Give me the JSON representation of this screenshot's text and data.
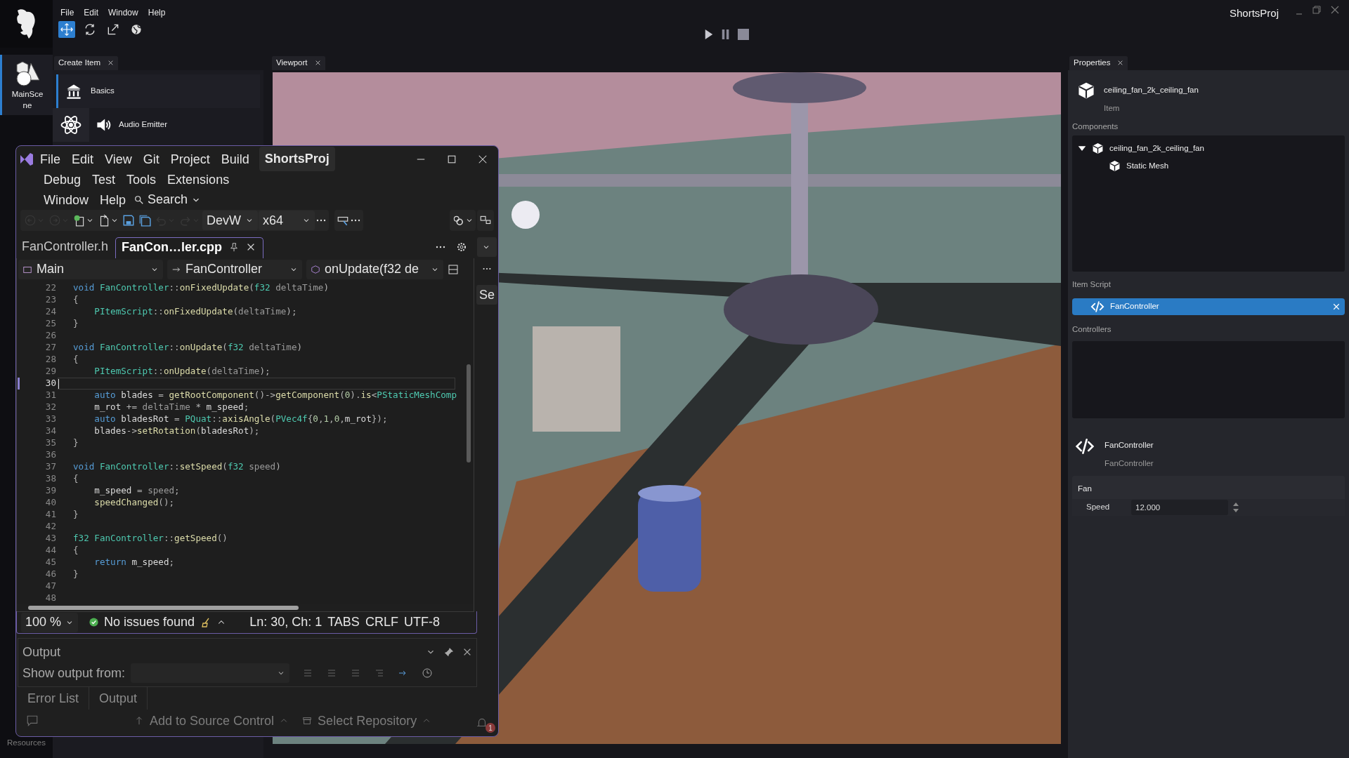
{
  "app": {
    "title": "ShortsProj",
    "menu": [
      "File",
      "Edit",
      "Window",
      "Help"
    ],
    "tools": [
      {
        "selected": true
      },
      {
        "selected": false
      },
      {
        "selected": false
      },
      {
        "selected": false
      }
    ]
  },
  "sidebar": {
    "items": [
      {
        "label": "MainScene",
        "selected": true
      },
      {
        "label": "Resources",
        "selected": false
      }
    ]
  },
  "create_panel": {
    "tab": "Create Item",
    "items": [
      {
        "label": "Basics",
        "selected": true
      },
      {
        "label": "Audio Emitter",
        "selected": false
      }
    ]
  },
  "viewport": {
    "tab": "Viewport",
    "kind": "picture"
  },
  "properties": {
    "tab": "Properties",
    "item": {
      "name": "ceiling_fan_2k_ceiling_fan",
      "type": "Item"
    },
    "components_label": "Components",
    "components": [
      {
        "label": "ceiling_fan_2k_ceiling_fan",
        "expanded": true,
        "children": [
          {
            "label": "Static Mesh"
          }
        ]
      }
    ],
    "script_label": "Item Script",
    "script": "FanController",
    "controllers_label": "Controllers",
    "controller": {
      "name": "FanController",
      "class": "FanController"
    },
    "group": "Fan",
    "fields": [
      {
        "label": "Speed",
        "value": "12.000"
      }
    ]
  },
  "ide": {
    "menu": [
      [
        "File",
        "Edit",
        "View",
        "Git",
        "Project",
        "Build"
      ],
      [
        "Debug",
        "Test",
        "Tools",
        "Extensions"
      ],
      [
        "Window",
        "Help"
      ]
    ],
    "search": "Search",
    "solution": "ShortsProj",
    "toolbar": [
      {
        "kind": "back",
        "disabled": true
      },
      {
        "kind": "forward",
        "disabled": true
      },
      {
        "kind": "new",
        "disabled": false
      },
      {
        "kind": "open",
        "disabled": false
      },
      {
        "kind": "save",
        "disabled": false
      },
      {
        "kind": "saveall",
        "disabled": false
      },
      {
        "kind": "undo",
        "disabled": true
      },
      {
        "kind": "redo",
        "disabled": true
      }
    ],
    "config": "DevW",
    "platform": "x64",
    "tabs": [
      {
        "label": "FanController.h",
        "selected": false
      },
      {
        "label": "FanCon…ler.cpp",
        "selected": true
      }
    ],
    "nav": [
      "Main",
      "FanController",
      "onUpdate(f32 de"
    ],
    "side_tab": "Se",
    "lines": [
      {
        "number": "22",
        "current": false,
        "tokens": [
          {
            "kind": "kw",
            "text": "void "
          },
          {
            "kind": "ty",
            "text": "FanController"
          },
          {
            "kind": "op",
            "text": "::"
          },
          {
            "kind": "fn",
            "text": "onFixedUpdate"
          },
          {
            "kind": "op",
            "text": "("
          },
          {
            "kind": "ty",
            "text": "f32"
          },
          {
            "kind": "pa",
            "text": " deltaTime"
          },
          {
            "kind": "op",
            "text": ")"
          }
        ]
      },
      {
        "number": "23",
        "current": false,
        "tokens": [
          {
            "kind": "op",
            "text": "{"
          }
        ]
      },
      {
        "number": "24",
        "current": false,
        "tokens": [
          {
            "kind": "ty",
            "text": "    PItemScript"
          },
          {
            "kind": "op",
            "text": "::"
          },
          {
            "kind": "fn",
            "text": "onFixedUpdate"
          },
          {
            "kind": "op",
            "text": "("
          },
          {
            "kind": "pa",
            "text": "deltaTime"
          },
          {
            "kind": "op",
            "text": ");"
          }
        ]
      },
      {
        "number": "25",
        "current": false,
        "tokens": [
          {
            "kind": "op",
            "text": "}"
          }
        ]
      },
      {
        "number": "26",
        "current": false
      },
      {
        "number": "27",
        "current": false,
        "tokens": [
          {
            "kind": "kw",
            "text": "void "
          },
          {
            "kind": "ty",
            "text": "FanController"
          },
          {
            "kind": "op",
            "text": "::"
          },
          {
            "kind": "fn",
            "text": "onUpdate"
          },
          {
            "kind": "op",
            "text": "("
          },
          {
            "kind": "ty",
            "text": "f32"
          },
          {
            "kind": "pa",
            "text": " deltaTime"
          },
          {
            "kind": "op",
            "text": ")"
          }
        ]
      },
      {
        "number": "28",
        "current": false,
        "tokens": [
          {
            "kind": "op",
            "text": "{"
          }
        ]
      },
      {
        "number": "29",
        "current": false,
        "tokens": [
          {
            "kind": "ty",
            "text": "    PItemScript"
          },
          {
            "kind": "op",
            "text": "::"
          },
          {
            "kind": "fn",
            "text": "onUpdate"
          },
          {
            "kind": "op",
            "text": "("
          },
          {
            "kind": "pa",
            "text": "deltaTime"
          },
          {
            "kind": "op",
            "text": ");"
          }
        ]
      },
      {
        "number": "30",
        "current": true
      },
      {
        "number": "31",
        "current": false,
        "tokens": [
          {
            "kind": "kw",
            "text": "    auto"
          },
          {
            "kind": "va",
            "text": " blades"
          },
          {
            "kind": "op",
            "text": " = "
          },
          {
            "kind": "fn",
            "text": "getRootComponent"
          },
          {
            "kind": "op",
            "text": "()->"
          },
          {
            "kind": "fn",
            "text": "getComponent"
          },
          {
            "kind": "op",
            "text": "("
          },
          {
            "kind": "nu",
            "text": "0"
          },
          {
            "kind": "op",
            "text": ")."
          },
          {
            "kind": "fn",
            "text": "is"
          },
          {
            "kind": "op",
            "text": "<"
          },
          {
            "kind": "ty",
            "text": "PStaticMeshComp"
          }
        ]
      },
      {
        "number": "32",
        "current": false,
        "tokens": [
          {
            "kind": "va",
            "text": "    m_rot"
          },
          {
            "kind": "op",
            "text": " += "
          },
          {
            "kind": "pa",
            "text": "deltaTime"
          },
          {
            "kind": "op",
            "text": " * "
          },
          {
            "kind": "va",
            "text": "m_speed"
          },
          {
            "kind": "op",
            "text": ";"
          }
        ]
      },
      {
        "number": "33",
        "current": false,
        "tokens": [
          {
            "kind": "kw",
            "text": "    auto"
          },
          {
            "kind": "va",
            "text": " bladesRot"
          },
          {
            "kind": "op",
            "text": " = "
          },
          {
            "kind": "ty",
            "text": "PQuat"
          },
          {
            "kind": "op",
            "text": "::"
          },
          {
            "kind": "fn",
            "text": "axisAngle"
          },
          {
            "kind": "op",
            "text": "("
          },
          {
            "kind": "ty",
            "text": "PVec4f"
          },
          {
            "kind": "op",
            "text": "{"
          },
          {
            "kind": "nu",
            "text": "0"
          },
          {
            "kind": "op",
            "text": ","
          },
          {
            "kind": "nu",
            "text": "1"
          },
          {
            "kind": "op",
            "text": ","
          },
          {
            "kind": "nu",
            "text": "0"
          },
          {
            "kind": "op",
            "text": ","
          },
          {
            "kind": "va",
            "text": "m_rot"
          },
          {
            "kind": "op",
            "text": "});"
          }
        ]
      },
      {
        "number": "34",
        "current": false,
        "tokens": [
          {
            "kind": "va",
            "text": "    blades"
          },
          {
            "kind": "op",
            "text": "->"
          },
          {
            "kind": "fn",
            "text": "setRotation"
          },
          {
            "kind": "op",
            "text": "("
          },
          {
            "kind": "va",
            "text": "bladesRot"
          },
          {
            "kind": "op",
            "text": ");"
          }
        ]
      },
      {
        "number": "35",
        "current": false,
        "tokens": [
          {
            "kind": "op",
            "text": "}"
          }
        ]
      },
      {
        "number": "36",
        "current": false
      },
      {
        "number": "37",
        "current": false,
        "tokens": [
          {
            "kind": "kw",
            "text": "void "
          },
          {
            "kind": "ty",
            "text": "FanController"
          },
          {
            "kind": "op",
            "text": "::"
          },
          {
            "kind": "fn",
            "text": "setSpeed"
          },
          {
            "kind": "op",
            "text": "("
          },
          {
            "kind": "ty",
            "text": "f32"
          },
          {
            "kind": "pa",
            "text": " speed"
          },
          {
            "kind": "op",
            "text": ")"
          }
        ]
      },
      {
        "number": "38",
        "current": false,
        "tokens": [
          {
            "kind": "op",
            "text": "{"
          }
        ]
      },
      {
        "number": "39",
        "current": false,
        "tokens": [
          {
            "kind": "va",
            "text": "    m_speed"
          },
          {
            "kind": "op",
            "text": " = "
          },
          {
            "kind": "pa",
            "text": "speed"
          },
          {
            "kind": "op",
            "text": ";"
          }
        ]
      },
      {
        "number": "40",
        "current": false,
        "tokens": [
          {
            "kind": "fn",
            "text": "    speedChanged"
          },
          {
            "kind": "op",
            "text": "();"
          }
        ]
      },
      {
        "number": "41",
        "current": false,
        "tokens": [
          {
            "kind": "op",
            "text": "}"
          }
        ]
      },
      {
        "number": "42",
        "current": false
      },
      {
        "number": "43",
        "current": false,
        "tokens": [
          {
            "kind": "ty",
            "text": "f32 FanController"
          },
          {
            "kind": "op",
            "text": "::"
          },
          {
            "kind": "fn",
            "text": "getSpeed"
          },
          {
            "kind": "op",
            "text": "()"
          }
        ]
      },
      {
        "number": "44",
        "current": false,
        "tokens": [
          {
            "kind": "op",
            "text": "{"
          }
        ]
      },
      {
        "number": "45",
        "current": false,
        "tokens": [
          {
            "kind": "kw",
            "text": "    return"
          },
          {
            "kind": "va",
            "text": " m_speed"
          },
          {
            "kind": "op",
            "text": ";"
          }
        ]
      },
      {
        "number": "46",
        "current": false,
        "tokens": [
          {
            "kind": "op",
            "text": "}"
          }
        ]
      },
      {
        "number": "47",
        "current": false
      },
      {
        "number": "48",
        "current": false
      }
    ],
    "status": {
      "zoom": "100 %",
      "issues": "No issues found",
      "position": "Ln: 30, Ch: 1",
      "indent": "TABS",
      "eol": "CRLF",
      "encoding": "UTF-8"
    },
    "output": {
      "title": "Output",
      "source_label": "Show output from:"
    },
    "bottom_tabs": [
      {
        "label": "Error List"
      },
      {
        "label": "Output"
      }
    ],
    "statusbar": {
      "source_control": "Add to Source Control",
      "repository": "Select Repository",
      "notifications": "1"
    }
  }
}
